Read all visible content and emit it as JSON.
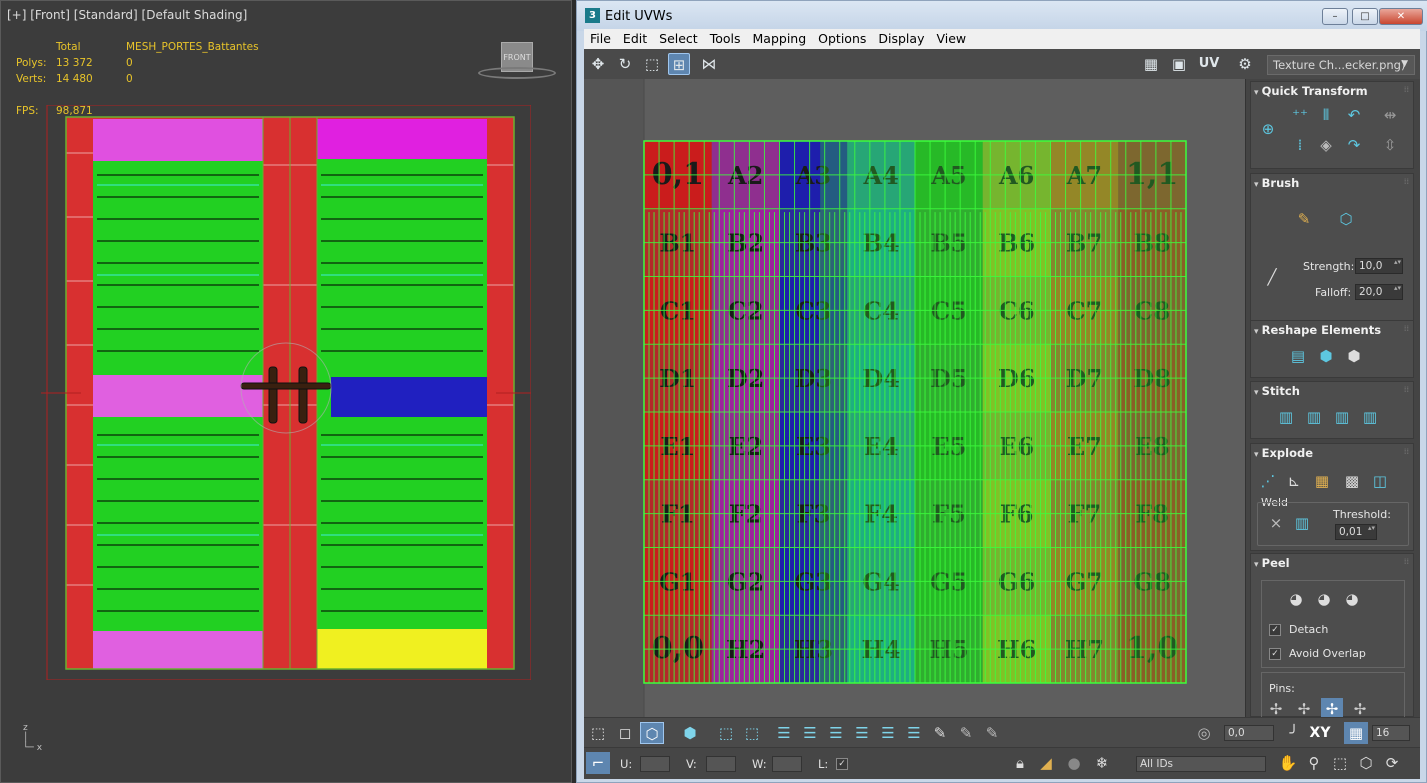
{
  "viewport": {
    "label": "[+] [Front] [Standard] [Default Shading]",
    "total_label": "Total",
    "object_name": "MESH_PORTES_Battantes",
    "polys_label": "Polys:",
    "polys_total": "13 372",
    "polys_sel": "0",
    "verts_label": "Verts:",
    "verts_total": "14 480",
    "verts_sel": "0",
    "fps_label": "FPS:",
    "fps_value": "98,871",
    "viewcube_label": "FRONT",
    "axis_z": "z",
    "axis_x": "x"
  },
  "window": {
    "title": "Edit UVWs",
    "app_icon": "3",
    "min_label": "–",
    "max_label": "□",
    "close_label": "✕"
  },
  "menu": [
    "File",
    "Edit",
    "Select",
    "Tools",
    "Mapping",
    "Options",
    "Display",
    "View"
  ],
  "toolbar": {
    "uv_label": "UV",
    "texture_select": "Texture Ch...ecker.png)",
    "dropdown_arrow": "▼"
  },
  "checker": {
    "rows": [
      "A",
      "B",
      "C",
      "D",
      "E",
      "F",
      "G",
      "H"
    ],
    "cells": [
      [
        "0,1",
        "A2",
        "A3",
        "A4",
        "A5",
        "A6",
        "A7",
        "1,1"
      ],
      [
        "B1",
        "B2",
        "B3",
        "B4",
        "B5",
        "B6",
        "B7",
        "B8"
      ],
      [
        "C1",
        "C2",
        "C3",
        "C4",
        "C5",
        "C6",
        "C7",
        "C8"
      ],
      [
        "D1",
        "D2",
        "D3",
        "D4",
        "D5",
        "D6",
        "D7",
        "D8"
      ],
      [
        "E1",
        "E2",
        "E3",
        "E4",
        "E5",
        "E6",
        "E7",
        "E8"
      ],
      [
        "F1",
        "F2",
        "F3",
        "F4",
        "F5",
        "F6",
        "F7",
        "F8"
      ],
      [
        "G1",
        "G2",
        "G3",
        "G4",
        "G5",
        "G6",
        "G7",
        "G8"
      ],
      [
        "0,0",
        "H2",
        "H3",
        "H4",
        "H5",
        "H6",
        "H7",
        "1,0"
      ]
    ],
    "column_colors": [
      "#d01818",
      "#a020a0",
      "#1a1ab0",
      "#10a0b0",
      "#20b020",
      "#b0c020",
      "#d06020",
      "#c02020"
    ]
  },
  "rollouts": {
    "quick_transform": "Quick Transform",
    "brush": "Brush",
    "strength_label": "Strength:",
    "strength_value": "10,0",
    "falloff_label": "Falloff:",
    "falloff_value": "20,0",
    "reshape": "Reshape Elements",
    "stitch": "Stitch",
    "explode": "Explode",
    "weld": "Weld",
    "threshold_label": "Threshold:",
    "threshold_value": "0,01",
    "peel": "Peel",
    "detach_label": "Detach",
    "avoid_overlap_label": "Avoid Overlap",
    "pins_label": "Pins:"
  },
  "bottom": {
    "rotate_value": "0,0",
    "xy_label": "XY",
    "grid_value": "16",
    "u_label": "U:",
    "v_label": "V:",
    "w_label": "W:",
    "l_label": "L:",
    "ids_select": "All IDs"
  },
  "colors": {
    "accent": "#5e86b0",
    "uv_wire": "#3cff3c",
    "icon_cyan": "#5dc7e0"
  }
}
